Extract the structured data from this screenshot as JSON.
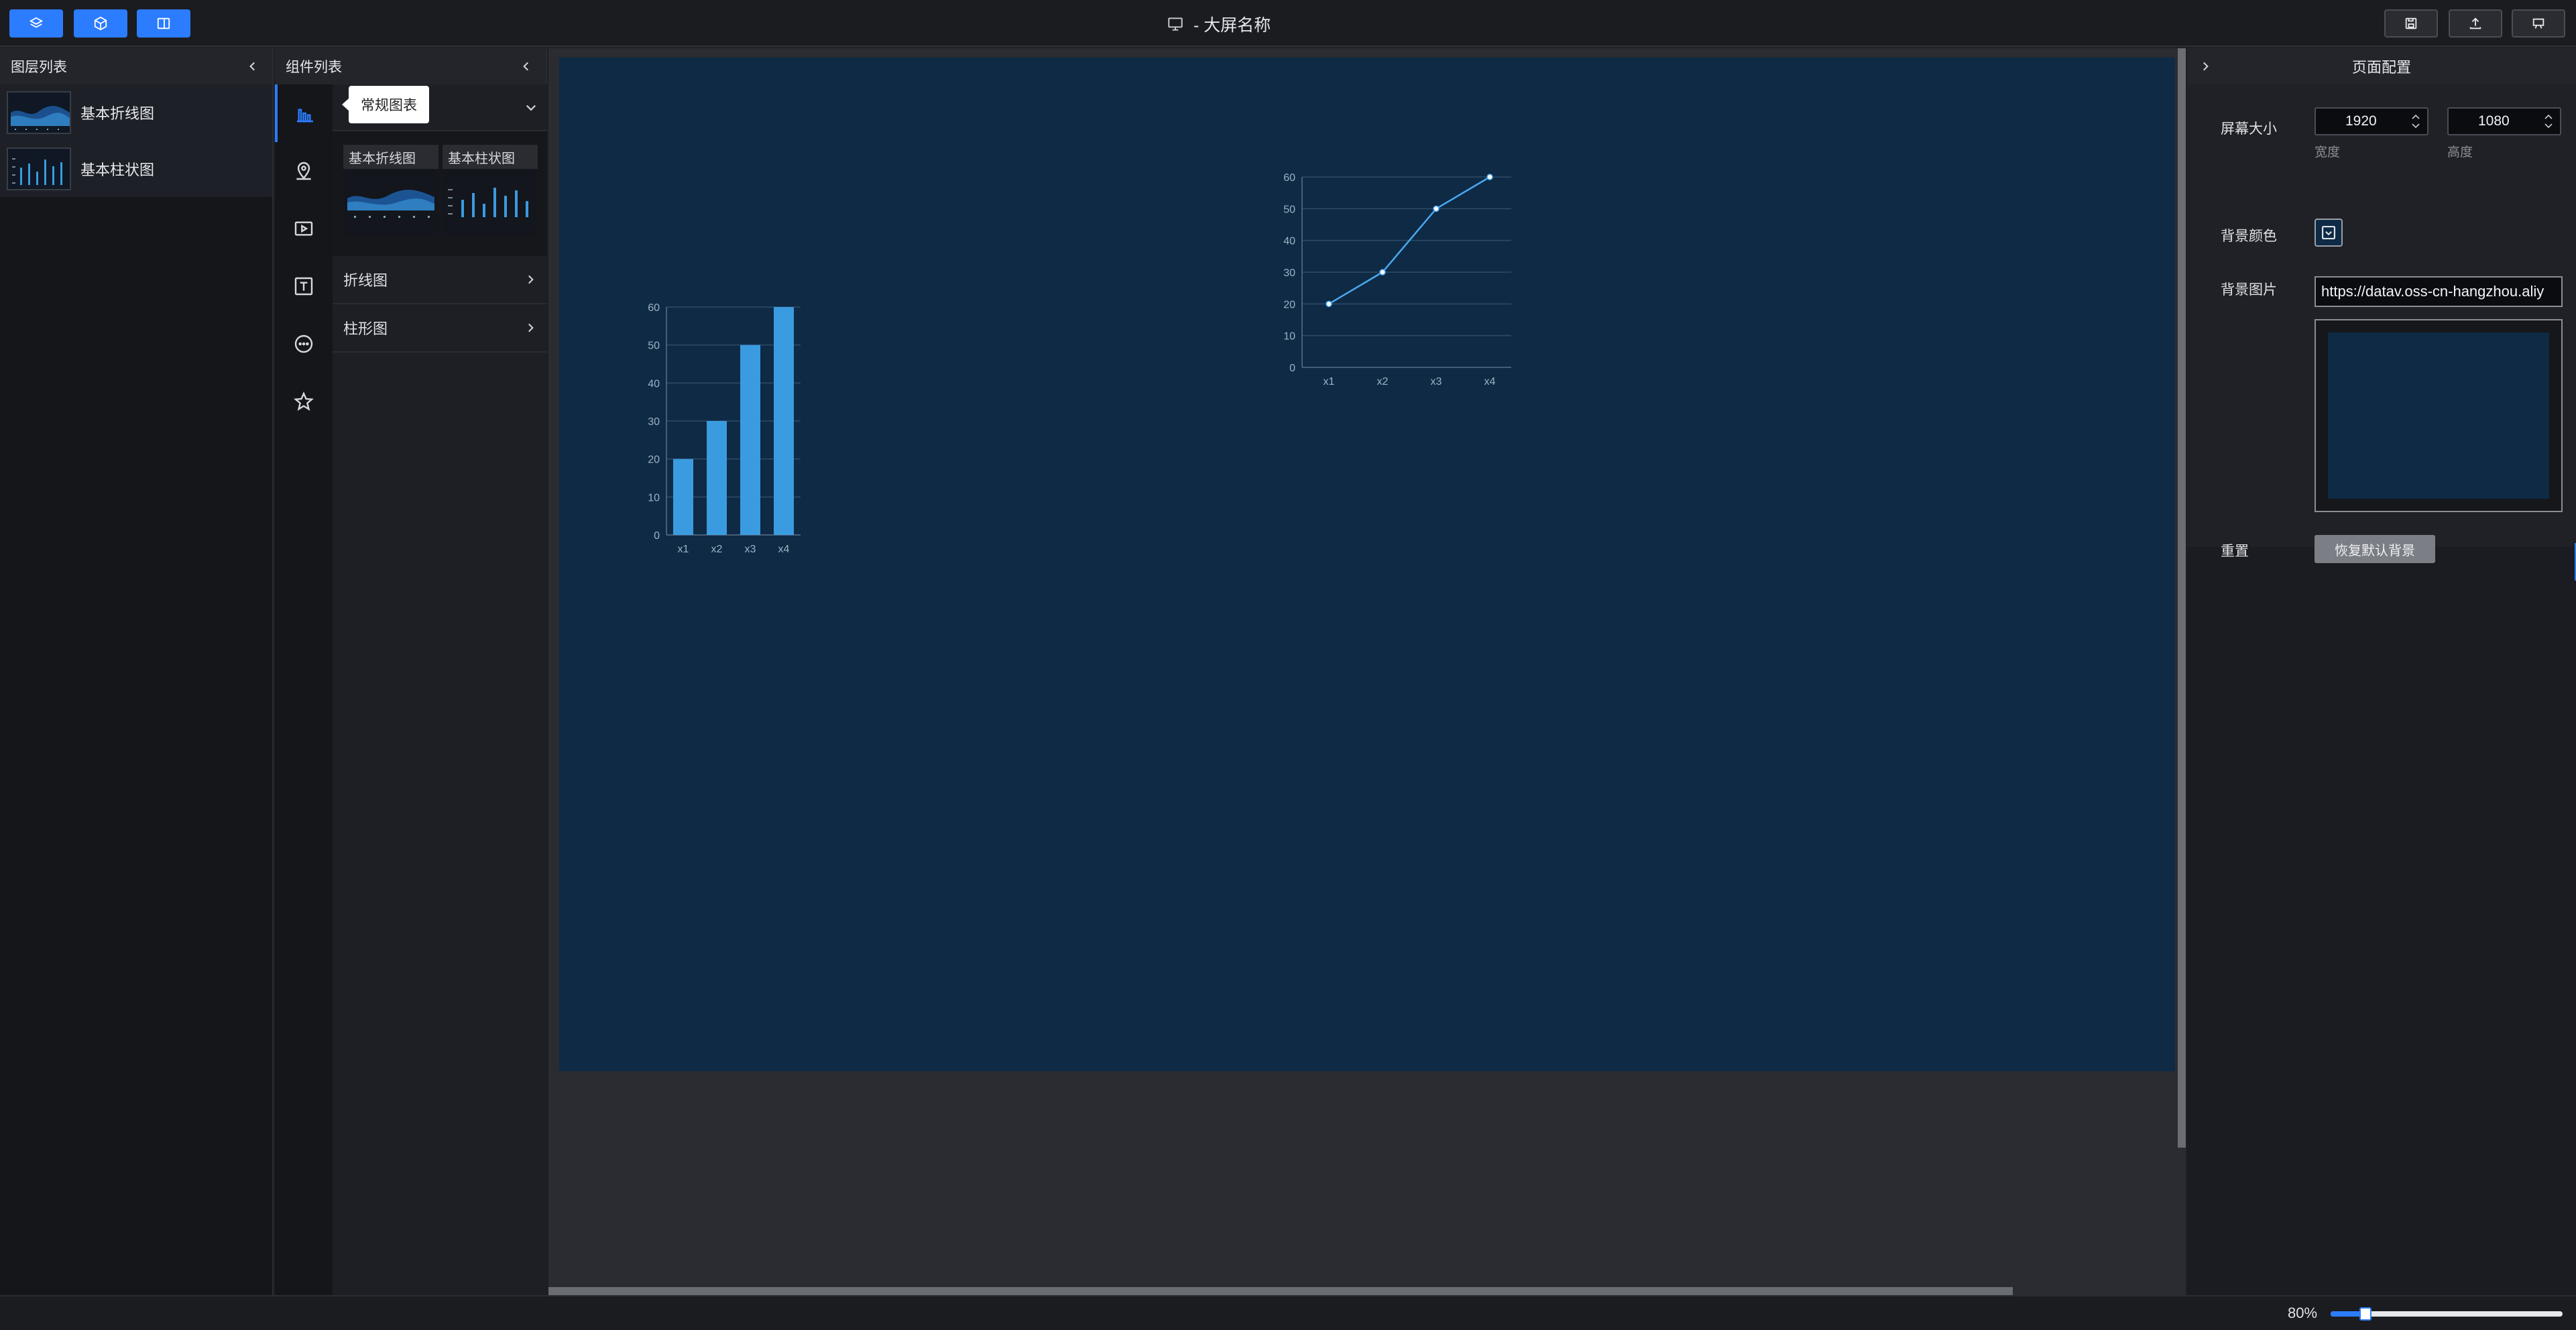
{
  "topbar": {
    "left_buttons": [
      {
        "icon": "layers-icon"
      },
      {
        "icon": "cube-icon"
      },
      {
        "icon": "panel-icon"
      }
    ],
    "title": "- 大屏名称",
    "title_icon": "monitor-icon",
    "right_buttons": [
      {
        "icon": "save-icon"
      },
      {
        "icon": "upload-icon"
      },
      {
        "icon": "preview-icon"
      }
    ],
    "accent_color": "#2b7cff"
  },
  "layer_panel": {
    "title": "图层列表",
    "items": [
      {
        "label": "基本折线图"
      },
      {
        "label": "基本柱状图"
      }
    ]
  },
  "component_panel": {
    "title": "组件列表",
    "rail_icons": [
      "bar-chart-icon",
      "map-pin-icon",
      "video-icon",
      "text-icon",
      "more-icon",
      "star-icon"
    ],
    "tooltip": "常规图表",
    "cards": [
      {
        "label": "基本折线图"
      },
      {
        "label": "基本柱状图"
      }
    ],
    "categories": [
      {
        "label": "折线图"
      },
      {
        "label": "柱形图"
      }
    ]
  },
  "canvas": {
    "background": "#0e2a45"
  },
  "right_panel": {
    "title": "页面配置",
    "screen_size_label": "屏幕大小",
    "width_value": "1920",
    "width_label": "宽度",
    "height_value": "1080",
    "height_label": "高度",
    "bg_color_label": "背景颜色",
    "bg_image_label": "背景图片",
    "bg_image_url": "https://datav.oss-cn-hangzhou.aliy",
    "reset_label": "重置",
    "reset_button": "恢复默认背景"
  },
  "bottom_bar": {
    "zoom_label": "80%",
    "zoom_fraction": 0.15
  },
  "chart_data": [
    {
      "type": "bar",
      "categories": [
        "x1",
        "x2",
        "x3",
        "x4"
      ],
      "values": [
        20,
        30,
        50,
        60
      ],
      "ylim": [
        0,
        60
      ],
      "yticks": [
        "0",
        "10",
        "20",
        "30",
        "40",
        "50",
        "60"
      ],
      "grid": true,
      "color": "#3b9be0"
    },
    {
      "type": "line",
      "categories": [
        "x1",
        "x2",
        "x3",
        "x4"
      ],
      "values": [
        20,
        30,
        50,
        60
      ],
      "ylim": [
        0,
        60
      ],
      "yticks": [
        "0",
        "10",
        "20",
        "30",
        "40",
        "50",
        "60"
      ],
      "grid": true,
      "color": "#4aa8f0"
    }
  ]
}
